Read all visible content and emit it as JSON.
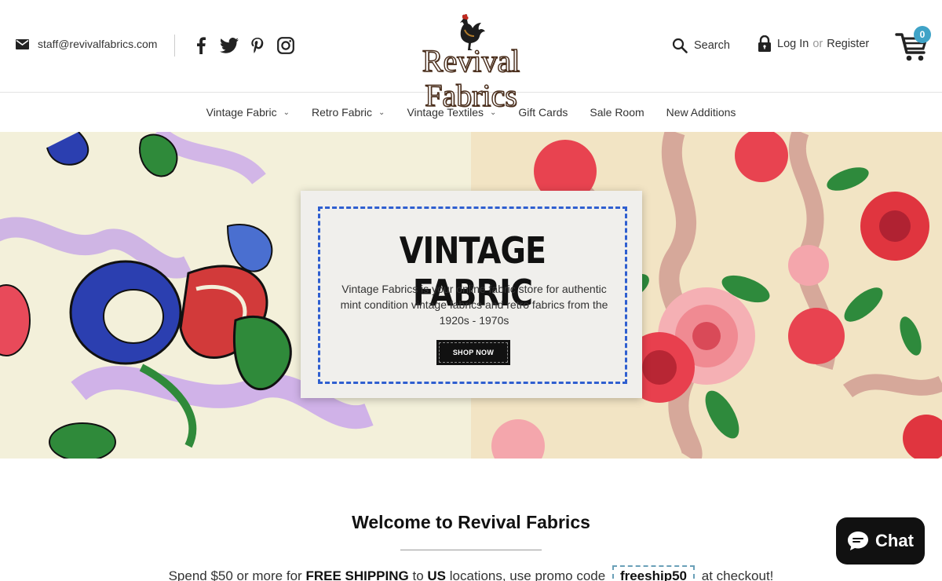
{
  "header": {
    "email": "staff@revivalfabrics.com",
    "logo_text": "Revival Fabrics",
    "search_label": "Search",
    "login_label": "Log In",
    "or_label": "or",
    "register_label": "Register",
    "cart_count": "0"
  },
  "socials": [
    "facebook-icon",
    "twitter-icon",
    "pinterest-icon",
    "instagram-icon"
  ],
  "nav": {
    "items": [
      {
        "label": "Vintage Fabric",
        "dropdown": true
      },
      {
        "label": "Retro Fabric",
        "dropdown": true
      },
      {
        "label": "Vintage Textiles",
        "dropdown": true
      },
      {
        "label": "Gift Cards",
        "dropdown": false
      },
      {
        "label": "Sale Room",
        "dropdown": false
      },
      {
        "label": "New Additions",
        "dropdown": false
      }
    ]
  },
  "hero": {
    "title": "VINTAGE FABRIC",
    "text": "Vintage  Fabrics is your online fabric store for authentic mint condition vintage fabrics and retro fabrics from the 1920s - 1970s",
    "button": "SHOP NOW"
  },
  "welcome": {
    "title": "Welcome to Revival Fabrics",
    "promo_pre": "Spend $50 or more for",
    "promo_bold1": "FREE SHIPPING",
    "promo_to": "to",
    "promo_bold2": "US",
    "promo_mid": "locations, use promo code",
    "promo_code": "freeship50",
    "promo_post": "at checkout!"
  },
  "chat": {
    "label": "Chat"
  },
  "colors": {
    "accent": "#3fa3c7",
    "label_border": "#2f5fd0",
    "chat_bg": "#111111"
  }
}
